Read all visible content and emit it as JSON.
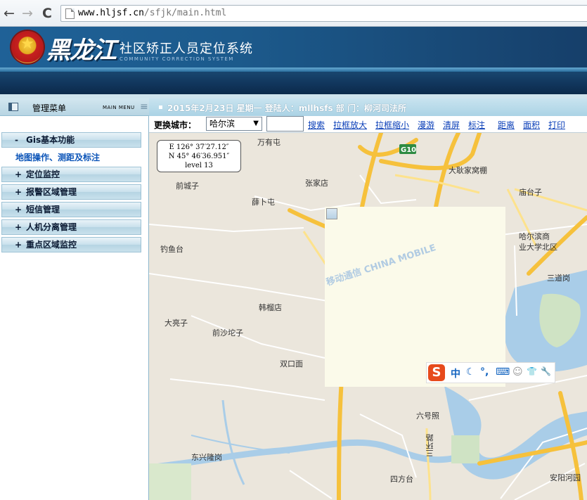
{
  "browser": {
    "url_host": "www.hljsf.cn",
    "url_path": "/sfjk/main.html",
    "back_glyph": "←",
    "forward_glyph": "→",
    "reload_glyph": "C"
  },
  "header": {
    "province": "黑龙江",
    "title": "社区矫正人员定位系统",
    "subtitle": "COMMUNITY CORRECTION SYSTEM"
  },
  "sidebar": {
    "title": "管理菜单",
    "subtitle": "MAIN MENU",
    "items": [
      {
        "sign": "-",
        "label": "Gis基本功能"
      },
      {
        "sign": "+",
        "label": "定位监控"
      },
      {
        "sign": "+",
        "label": "报警区域管理"
      },
      {
        "sign": "+",
        "label": "短信管理"
      },
      {
        "sign": "+",
        "label": "人机分离管理"
      },
      {
        "sign": "+",
        "label": "重点区域监控"
      }
    ],
    "submenu_label": "地图操作、测距及标注"
  },
  "info_bar": {
    "text": "2015年2月23日 星期一 登陆人：mllhsfs 部 门：柳河司法所"
  },
  "toolbar": {
    "city_label": "更换城市：",
    "city_value": "哈尔滨",
    "search_value": "",
    "links": [
      "搜索",
      "拉框放大",
      "拉框缩小",
      "漫游",
      "清屏",
      "标注",
      "距离",
      "面积",
      "打印"
    ]
  },
  "map": {
    "coord_e": "E 126° 37′27.12″",
    "coord_n": "N 45° 46′36.951″",
    "level": "level 13",
    "labels": [
      "万有屯",
      "G10",
      "大耿家窝棚",
      "前城子",
      "张家店",
      "庙台子",
      "薛卜屯",
      "哈尔滨商",
      "业大学北区",
      "钓鱼台",
      "三道岗",
      "韩榴店",
      "大亮子",
      "前沙坨子",
      "双口面",
      "六号照",
      "三环路",
      "东兴隆岗",
      "四方台",
      "安阳河园"
    ],
    "watermark": "移动通信 CHINA MOBILE",
    "ime": {
      "logo": "S",
      "items": [
        "中",
        "☾",
        "°,",
        "⌨",
        "☺",
        "👕",
        "🔧"
      ]
    }
  }
}
